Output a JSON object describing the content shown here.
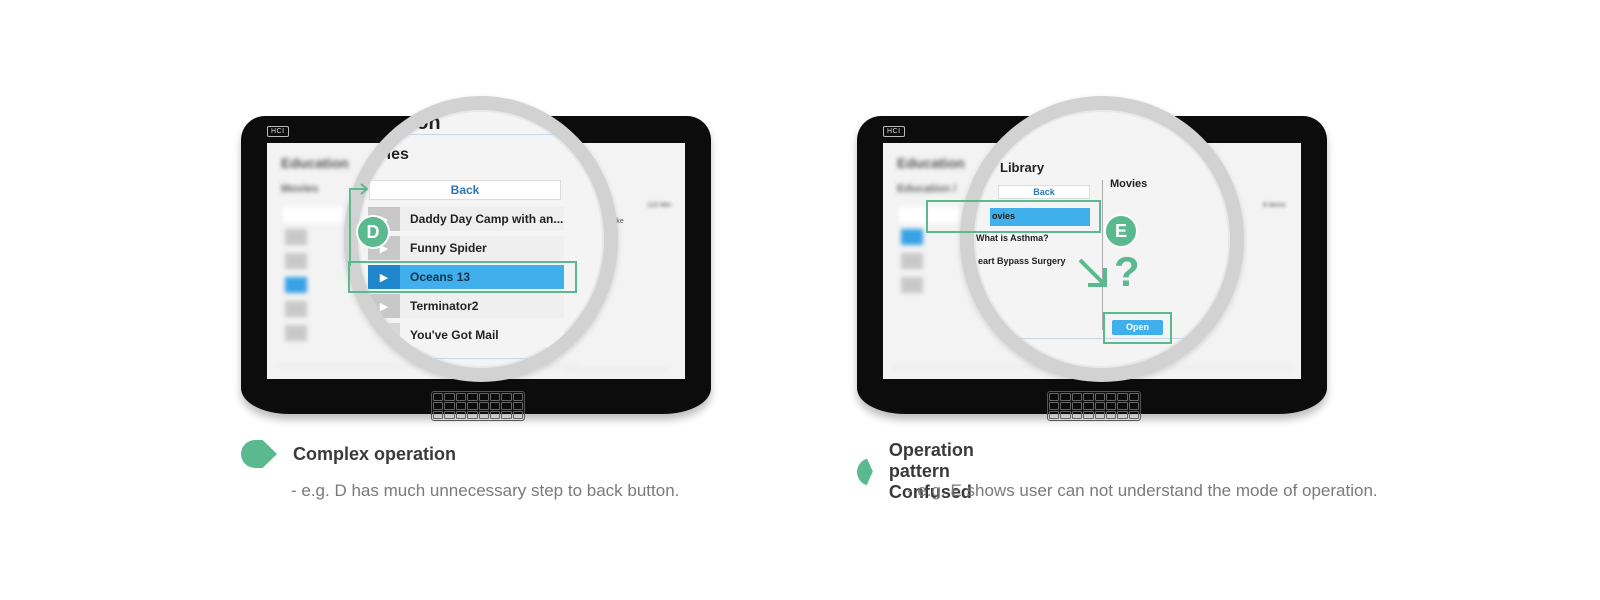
{
  "colors": {
    "accent_green": "#5bb98f",
    "select_blue": "#3fb0ec",
    "device_black": "#0c0c0c"
  },
  "device": {
    "logo_text": "HCI"
  },
  "left": {
    "magnifier": {
      "heading_top": "tion",
      "heading": "ovies",
      "back_label": "Back",
      "items": [
        {
          "label": "Daddy Day Camp with an..."
        },
        {
          "label": "Funny Spider"
        },
        {
          "label": "Oceans 13",
          "selected": true
        },
        {
          "label": "Terminator2"
        },
        {
          "label": "You've Got Mail"
        }
      ],
      "play_icon": "play-icon"
    },
    "badge": "D",
    "title": "Complex operation",
    "description": "- e.g. D has much unnecessary step to back button."
  },
  "right": {
    "magnifier": {
      "heading": "Library",
      "back_label": "Back",
      "column_heading": "Movies",
      "items": [
        {
          "label": "ovies",
          "selected": true
        },
        {
          "label": "What is Asthma?"
        },
        {
          "label": "eart Bypass Surgery"
        }
      ],
      "open_label": "Open",
      "question_mark": "?"
    },
    "badge": "E",
    "title": "Operation pattern Confused",
    "description": "- e.g. E shows user can not understand the mode of operation."
  }
}
